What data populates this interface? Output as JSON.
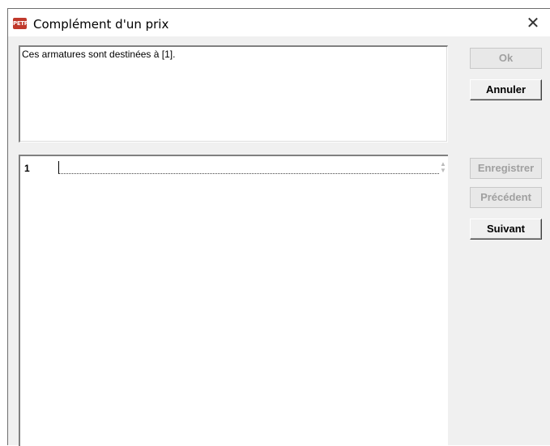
{
  "window": {
    "title": "Complément d'un prix",
    "app_icon_text": "PETRA",
    "close_glyph": "✕"
  },
  "text": "Ces armatures sont destinées à [1].",
  "fields": [
    {
      "number": "1",
      "value": ""
    }
  ],
  "buttons": {
    "ok": {
      "label": "Ok",
      "enabled": false
    },
    "cancel": {
      "label": "Annuler",
      "enabled": true
    },
    "save": {
      "label": "Enregistrer",
      "enabled": false
    },
    "previous": {
      "label": "Précédent",
      "enabled": false
    },
    "next": {
      "label": "Suivant",
      "enabled": true
    }
  },
  "icons": {
    "app": "petra-app-icon",
    "close": "close-icon",
    "spin": "spin-arrows-icon"
  },
  "colors": {
    "app_icon": "#c0392b",
    "dialog_bg": "#f0f0f0",
    "disabled_text": "#a0a0a0"
  }
}
